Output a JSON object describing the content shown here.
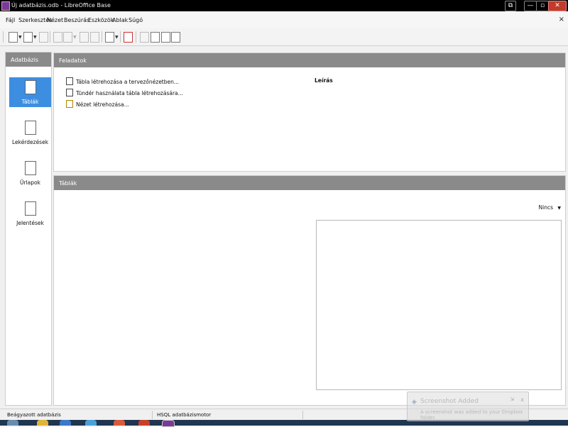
{
  "window": {
    "title": "Új adatbázis.odb - LibreOffice Base",
    "buttons": {
      "restore_other": "⧉",
      "minimize": "—",
      "maximize": "▫",
      "close": "✕"
    }
  },
  "menu": {
    "items": [
      "Fájl",
      "Szerkesztés",
      "Nézet",
      "Beszúrás",
      "Eszközök",
      "Ablak",
      "Súgó"
    ],
    "close_doc": "×"
  },
  "left_panel": {
    "header": "Adatbázis",
    "items": [
      {
        "label": "Táblák",
        "icon": "tables-icon",
        "selected": true
      },
      {
        "label": "Lekérdezések",
        "icon": "queries-icon",
        "selected": false
      },
      {
        "label": "Űrlapok",
        "icon": "forms-icon",
        "selected": false
      },
      {
        "label": "Jelentések",
        "icon": "reports-icon",
        "selected": false
      }
    ]
  },
  "tasks_panel": {
    "header": "Feladatok",
    "tasks": [
      {
        "label": "Tábla létrehozása a tervezőnézetben...",
        "icon": "design-table-icon"
      },
      {
        "label": "Tündér használata tábla létrehozására...",
        "icon": "wizard-table-icon"
      },
      {
        "label": "Nézet létrehozása...",
        "icon": "create-view-icon"
      }
    ],
    "description_label": "Leírás"
  },
  "tables_panel": {
    "header": "Táblák",
    "preview_select": "Nincs"
  },
  "status_bar": {
    "left": "Beágyazott adatbázis",
    "middle": "HSQL adatbázismotor"
  },
  "toast": {
    "title": "Screenshot Added",
    "body": "A screenshot was added to your Dropbox folder.",
    "close": "x",
    "pin": "⇲"
  },
  "colors": {
    "selection": "#3d8ee0",
    "panel_header": "#8a8a8a",
    "titlebar": "#000000"
  }
}
